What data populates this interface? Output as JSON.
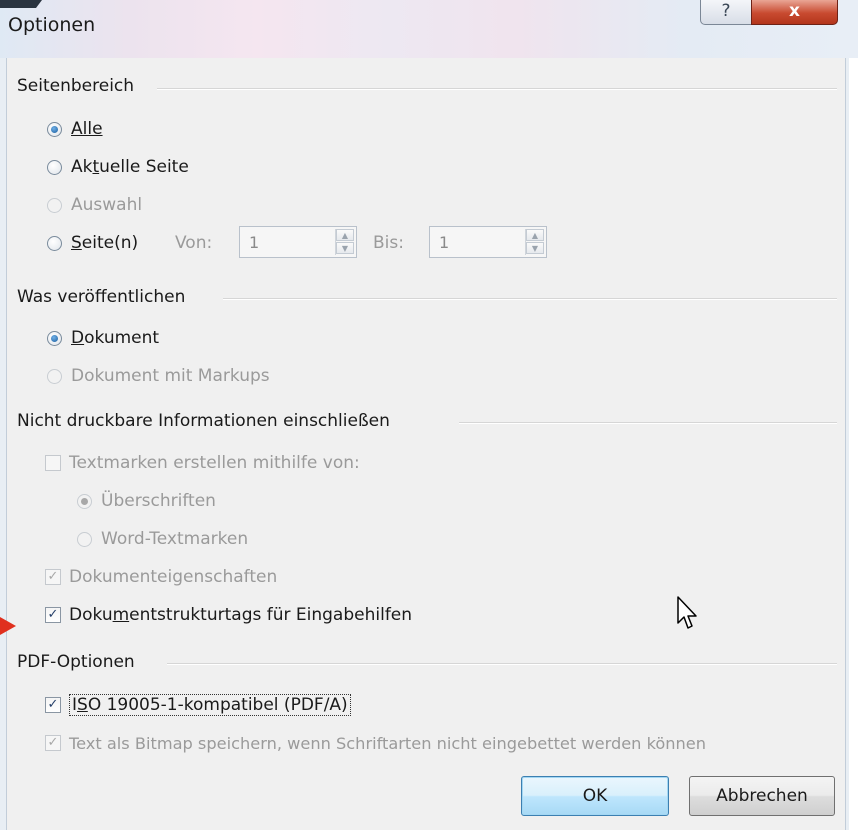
{
  "window": {
    "title": "Optionen",
    "help_label": "?",
    "close_label": "x"
  },
  "seitenbereich": {
    "header": "Seitenbereich",
    "alle": "Alle",
    "aktuelle_seite_pre": "Ak",
    "aktuelle_seite_u": "t",
    "aktuelle_seite_post": "uelle Seite",
    "auswahl": "Auswahl",
    "seiten_u": "S",
    "seiten_post": "eite(n)",
    "von_label": "Von:",
    "von_value": "1",
    "bis_label": "Bis:",
    "bis_value": "1"
  },
  "veroeffentlichen": {
    "header": "Was veröffentlichen",
    "dokument_u": "D",
    "dokument_post": "okument",
    "dokument_markups": "Dokument mit Markups"
  },
  "nicht_druckbar": {
    "header": "Nicht druckbare Informationen einschließen",
    "textmarken": "Textmarken erstellen mithilfe von:",
    "ueberschriften": "Überschriften",
    "word_textmarken": "Word-Textmarken",
    "dokumenteigenschaften": "Dokumenteigenschaften",
    "strukturtags_pre": "Doku",
    "strukturtags_u": "m",
    "strukturtags_post": "entstrukturtags für Eingabehilfen"
  },
  "pdf_optionen": {
    "header": "PDF-Optionen",
    "iso_pre": "I",
    "iso_u": "S",
    "iso_post": "O 19005-1-kompatibel (PDF/A)",
    "bitmap": "Text als Bitmap speichern, wenn Schriftarten nicht eingebettet werden können"
  },
  "buttons": {
    "ok": "OK",
    "abbrechen": "Abbrechen"
  },
  "glyphs": {
    "check": "✓",
    "up": "▲",
    "down": "▼"
  },
  "colors": {
    "accent": "#1c5e9e",
    "close": "#c84a30",
    "marker": "#e0301e"
  }
}
